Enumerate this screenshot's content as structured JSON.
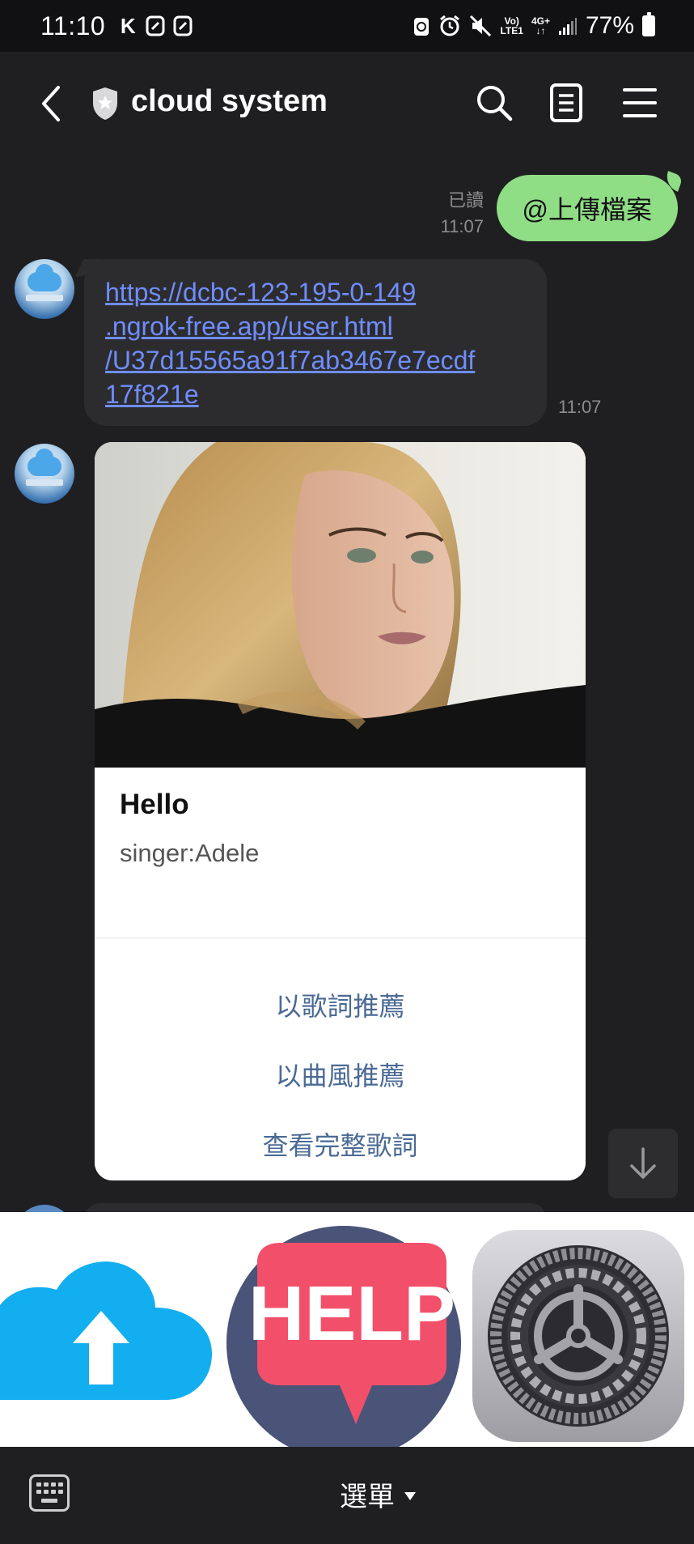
{
  "status_bar": {
    "time": "11:10",
    "left_icons": [
      "k-app-icon",
      "note-icon",
      "note-icon"
    ],
    "net_top": "Vo)",
    "net_bottom": "LTE1",
    "net_type": "4G+",
    "battery": "77%"
  },
  "header": {
    "title": "cloud system",
    "icons": [
      "back-icon",
      "shield-icon",
      "search-icon",
      "notes-icon",
      "menu-icon"
    ]
  },
  "messages": {
    "outgoing": {
      "read_label": "已讀",
      "time": "11:07",
      "text": "@上傳檔案"
    },
    "link": {
      "lines": [
        "https://dcbc-123-195-0-149",
        ".ngrok-free.app/user.html",
        "/U37d15565a91f7ab3467e7ecdf",
        "17f821e"
      ],
      "time": "11:07"
    },
    "card": {
      "title": "Hello",
      "singer": "singer:Adele",
      "actions": [
        "以歌詞推薦",
        "以曲風推薦",
        "查看完整歌詞"
      ]
    }
  },
  "rich_menu": {
    "upload_icon": "cloud-upload-icon",
    "help_text": "HELP",
    "settings_icon": "settings-gear-icon"
  },
  "bottom_bar": {
    "menu_label": "選單",
    "keyboard_icon": "keyboard-icon"
  },
  "colors": {
    "background": "#1f1f21",
    "outgoing_bubble": "#8fde86",
    "incoming_bubble": "#2c2c2e",
    "link": "#6f8dff",
    "card_action": "#4a6a95",
    "help_red": "#f2506a",
    "help_navy": "#4a5378",
    "cloud_blue": "#12aef0"
  }
}
